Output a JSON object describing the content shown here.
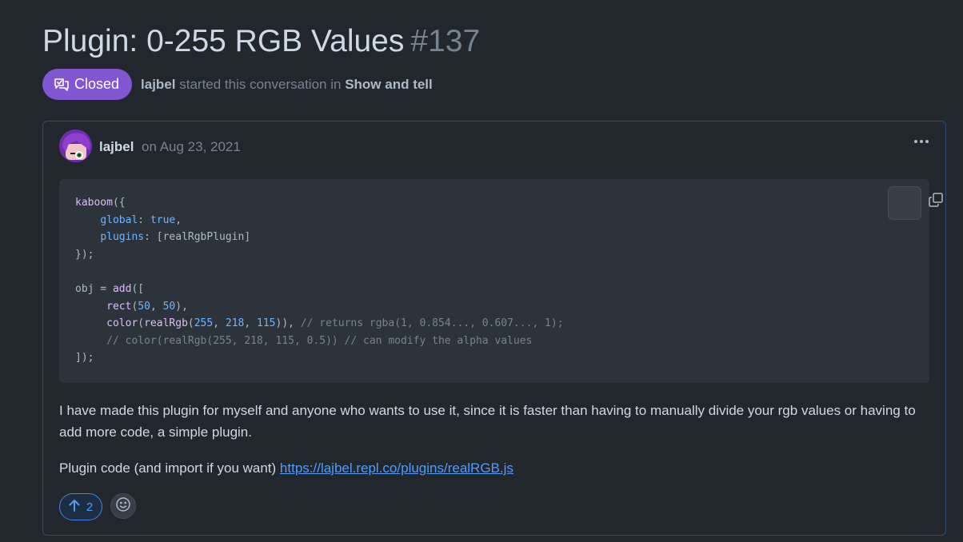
{
  "discussion": {
    "title": "Plugin: 0-255 RGB Values",
    "number": "#137",
    "status": "Closed",
    "status_icon": "discussion-closed-icon",
    "author": "lajbel",
    "started_text": "started this conversation in",
    "category": "Show and tell"
  },
  "post": {
    "author": "lajbel",
    "date": "on Aug 23, 2021",
    "menu_icon": "kebab-horizontal-icon",
    "copy_icon": "copy-icon",
    "code": {
      "l1a": "kaboom",
      "l1b": "({",
      "l2a": "global",
      "l2b": ": ",
      "l2c": "true",
      "l2d": ",",
      "l3a": "plugins",
      "l3b": ": [realRgbPlugin]",
      "l4": "});",
      "l6a": "obj = ",
      "l6b": "add",
      "l6c": "([",
      "l7a": "rect",
      "l7b": "(",
      "l7c": "50",
      "l7d": ", ",
      "l7e": "50",
      "l7f": "),",
      "l8a": "color",
      "l8b": "(",
      "l8c": "realRgb",
      "l8d": "(",
      "l8e": "255",
      "l8f": ", ",
      "l8g": "218",
      "l8h": ", ",
      "l8i": "115",
      "l8j": ")), ",
      "l8k": "// returns rgba(1, 0.854..., 0.607..., 1);",
      "l9": "// color(realRgb(255, 218, 115, 0.5)) // can modify the alpha values",
      "l10": "]);"
    },
    "paragraph1": "I have made this plugin for myself and anyone who wants to use it, since it is faster than having to manually divide your rgb values or having to add more code, a simple plugin.",
    "paragraph2_prefix": "Plugin code (and import if you want) ",
    "link": "https://lajbel.repl.co/plugins/realRGB.js",
    "upvote_icon": "arrow-up-icon",
    "upvotes": "2",
    "reaction_icon": "smiley-icon"
  },
  "colors": {
    "background": "#22272e",
    "badge": "#8256d0",
    "link": "#539bf5",
    "code_bg": "#2d333b"
  }
}
